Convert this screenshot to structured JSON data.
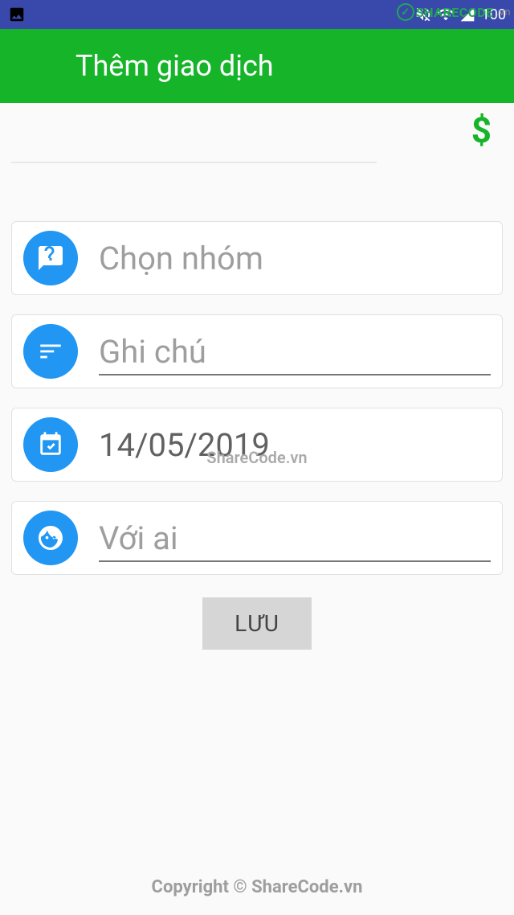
{
  "status_bar": {
    "battery_label": "100"
  },
  "watermark": {
    "brand": "SHARECODE",
    "suffix": ".vn",
    "center": "ShareCode.vn"
  },
  "app_bar": {
    "title": "Thêm giao dịch"
  },
  "amount": {
    "currency": "$"
  },
  "fields": {
    "group": {
      "label": "Chọn nhóm"
    },
    "note": {
      "placeholder": "Ghi chú"
    },
    "date": {
      "value": "14/05/2019"
    },
    "person": {
      "placeholder": "Với ai"
    }
  },
  "save_button": {
    "label": "LƯU"
  },
  "footer": {
    "copyright": "Copyright © ShareCode.vn"
  }
}
